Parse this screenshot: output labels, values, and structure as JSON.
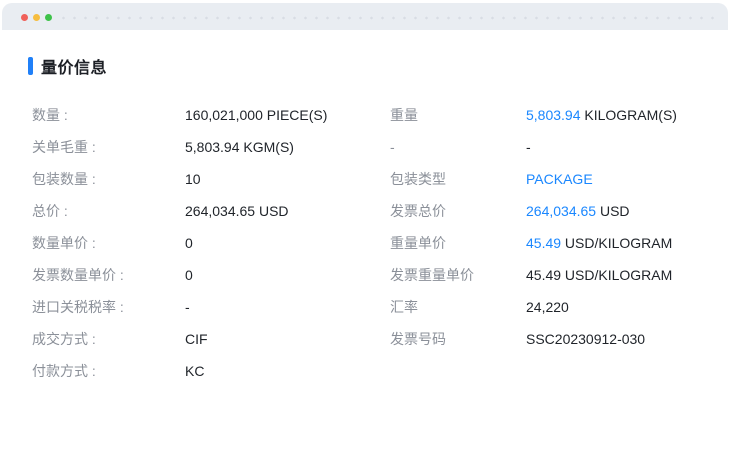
{
  "window": {
    "colors": {
      "titlebar_bg": "#e9edf2",
      "close_dot": "#f0605a",
      "minimize_dot": "#f6bd3f",
      "zoom_dot": "#3ec24a",
      "accent_blue": "#2080f8",
      "link_blue": "#1a87ff",
      "label_gray": "#8b9099",
      "value_dark": "#1f2329"
    }
  },
  "section": {
    "title": "量价信息"
  },
  "fields": {
    "left": [
      {
        "label": "数量 :",
        "value": "160,021,000 PIECE(S)"
      },
      {
        "label": "关单毛重 :",
        "value": "5,803.94 KGM(S)"
      },
      {
        "label": "包装数量 :",
        "value": "10"
      },
      {
        "label": "总价 :",
        "value": "264,034.65 USD"
      },
      {
        "label": "数量单价 :",
        "value": "0"
      },
      {
        "label": "发票数量单价 :",
        "value": "0"
      },
      {
        "label": "进口关税税率 :",
        "value": "-"
      },
      {
        "label": "成交方式 :",
        "value": "CIF"
      },
      {
        "label": "付款方式 :",
        "value": "KC"
      }
    ],
    "right": [
      {
        "label": "重量",
        "accent": "5,803.94",
        "rest": " KILOGRAM(S)"
      },
      {
        "label": "-",
        "accent": "",
        "rest": "-"
      },
      {
        "label": "包装类型",
        "accent": "PACKAGE",
        "rest": ""
      },
      {
        "label": "发票总价",
        "accent": "264,034.65",
        "rest": " USD"
      },
      {
        "label": "重量单价",
        "accent": "45.49",
        "rest": " USD/KILOGRAM"
      },
      {
        "label": "发票重量单价",
        "accent": "",
        "rest": "45.49 USD/KILOGRAM"
      },
      {
        "label": "汇率",
        "accent": "",
        "rest": "24,220"
      },
      {
        "label": "发票号码",
        "accent": "",
        "rest": "SSC20230912-030"
      }
    ]
  }
}
